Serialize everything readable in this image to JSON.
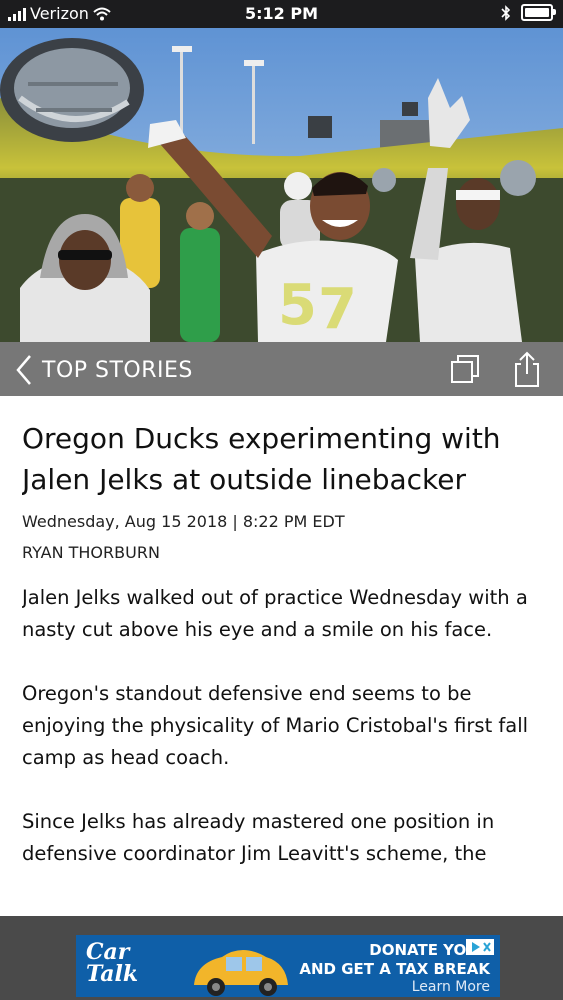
{
  "status_bar": {
    "carrier": "Verizon",
    "time": "5:12 PM"
  },
  "nav": {
    "back_label": "TOP STORIES"
  },
  "article": {
    "headline": "Oregon Ducks experimenting with Jalen Jelks at outside linebacker",
    "dateline": "Wednesday, Aug 15 2018 | 8:22 PM EDT",
    "author": "RYAN THORBURN",
    "paragraphs": [
      "Jalen Jelks walked out of practice Wednesday with a nasty cut above his eye and a smile on his face.",
      "Oregon's standout defensive end seems to be enjoying the physicality of Mario Cristobal's first fall camp as head coach.",
      "Since Jelks has already mastered one position in defensive coordinator Jim Leavitt's scheme, the"
    ]
  },
  "ad": {
    "logo_line1": "Car",
    "logo_line2": "Talk",
    "line1": "DONATE YOUR",
    "line2": "AND GET A TAX BREAK",
    "learn": "Learn More"
  },
  "colors": {
    "nav_bg": "#777777",
    "ad_bg": "#0f5fa8",
    "jersey": "#e8e8e8",
    "sky": "#6f9ed6"
  }
}
